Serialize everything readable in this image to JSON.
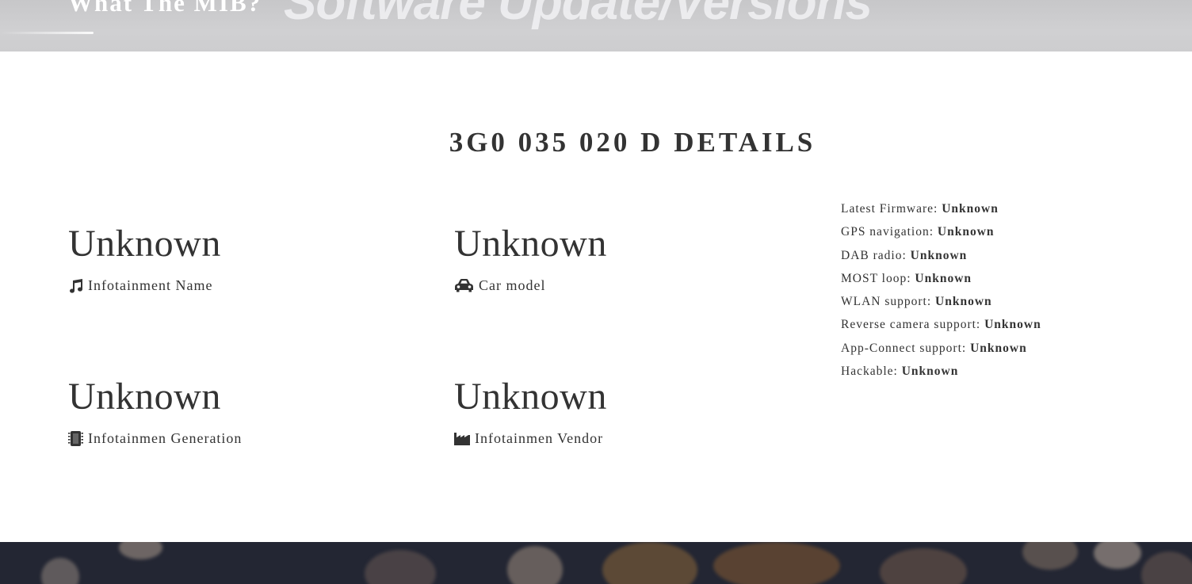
{
  "banner": {
    "brand": "What The MIB?",
    "background_text": "Software Update/Versions"
  },
  "details": {
    "title": "3G0 035 020 D DETAILS",
    "stats": {
      "infotainment_name": {
        "value": "Unknown",
        "label": "Infotainment Name",
        "icon": "music-note-icon"
      },
      "car_model": {
        "value": "Unknown",
        "label": "Car model",
        "icon": "car-icon"
      },
      "generation": {
        "value": "Unknown",
        "label": "Infotainmen Generation",
        "icon": "chip-icon"
      },
      "vendor": {
        "value": "Unknown",
        "label": "Infotainmen Vendor",
        "icon": "factory-icon"
      }
    },
    "features": [
      {
        "label": "Latest Firmware:",
        "value": "Unknown"
      },
      {
        "label": "GPS navigation:",
        "value": "Unknown"
      },
      {
        "label": "DAB radio:",
        "value": "Unknown"
      },
      {
        "label": "MOST loop:",
        "value": "Unknown"
      },
      {
        "label": "WLAN support:",
        "value": "Unknown"
      },
      {
        "label": "Reverse camera support:",
        "value": "Unknown"
      },
      {
        "label": "App-Connect support:",
        "value": "Unknown"
      },
      {
        "label": "Hackable:",
        "value": "Unknown"
      }
    ]
  },
  "colors": {
    "text": "#333333",
    "top_banner": "#cecfd1",
    "bottom_banner": "#232633"
  }
}
